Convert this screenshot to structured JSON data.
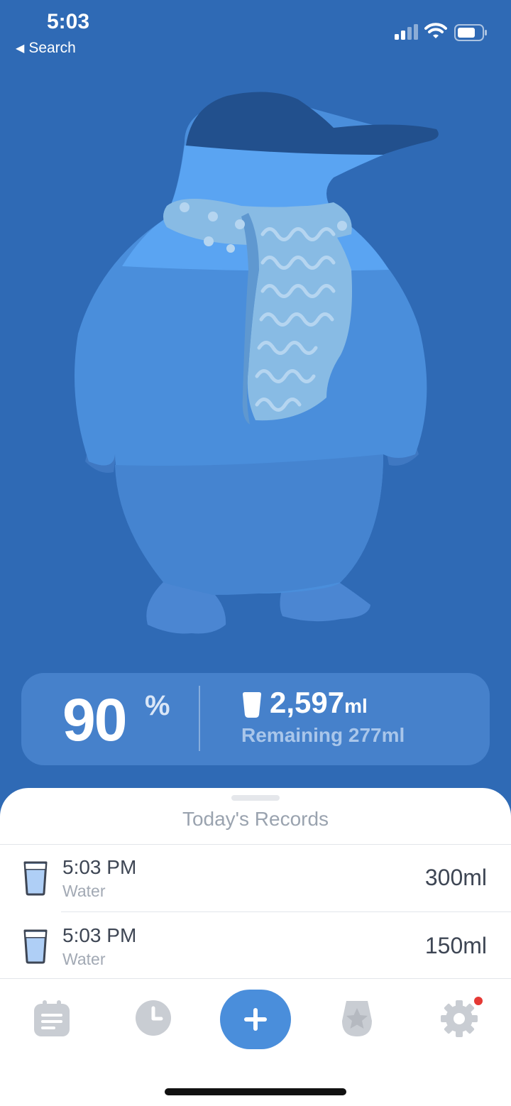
{
  "status_bar": {
    "time": "5:03",
    "back_label": "Search"
  },
  "summary": {
    "percent": "90",
    "percent_sign": "%",
    "amount": "2,597",
    "unit": "ml",
    "remaining": "Remaining 277ml",
    "progress": 0.9
  },
  "records": {
    "title": "Today's Records",
    "items": [
      {
        "time": "5:03 PM",
        "type": "Water",
        "amount": "300ml"
      },
      {
        "time": "5:03 PM",
        "type": "Water",
        "amount": "150ml"
      }
    ]
  },
  "tabbar": {
    "tabs": [
      {
        "icon": "records-icon"
      },
      {
        "icon": "history-clock-icon"
      },
      {
        "icon": "add-icon"
      },
      {
        "icon": "achievements-icon"
      },
      {
        "icon": "settings-gear-icon"
      }
    ],
    "settings_has_badge": true
  },
  "colors": {
    "background": "#2F6AB5",
    "penguin_body": "#4A8EDB",
    "penguin_hat": "#22508D",
    "scarf": "#88BBE4",
    "accent": "#4A8EDB",
    "badge": "#E53935"
  }
}
